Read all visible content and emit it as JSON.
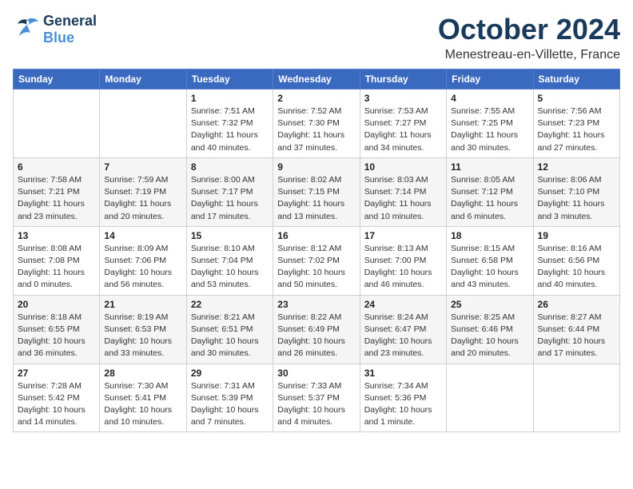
{
  "header": {
    "logo_general": "General",
    "logo_blue": "Blue",
    "month_title": "October 2024",
    "location": "Menestreau-en-Villette, France"
  },
  "weekdays": [
    "Sunday",
    "Monday",
    "Tuesday",
    "Wednesday",
    "Thursday",
    "Friday",
    "Saturday"
  ],
  "weeks": [
    [
      {
        "day": "",
        "info": ""
      },
      {
        "day": "",
        "info": ""
      },
      {
        "day": "1",
        "info": "Sunrise: 7:51 AM\nSunset: 7:32 PM\nDaylight: 11 hours\nand 40 minutes."
      },
      {
        "day": "2",
        "info": "Sunrise: 7:52 AM\nSunset: 7:30 PM\nDaylight: 11 hours\nand 37 minutes."
      },
      {
        "day": "3",
        "info": "Sunrise: 7:53 AM\nSunset: 7:27 PM\nDaylight: 11 hours\nand 34 minutes."
      },
      {
        "day": "4",
        "info": "Sunrise: 7:55 AM\nSunset: 7:25 PM\nDaylight: 11 hours\nand 30 minutes."
      },
      {
        "day": "5",
        "info": "Sunrise: 7:56 AM\nSunset: 7:23 PM\nDaylight: 11 hours\nand 27 minutes."
      }
    ],
    [
      {
        "day": "6",
        "info": "Sunrise: 7:58 AM\nSunset: 7:21 PM\nDaylight: 11 hours\nand 23 minutes."
      },
      {
        "day": "7",
        "info": "Sunrise: 7:59 AM\nSunset: 7:19 PM\nDaylight: 11 hours\nand 20 minutes."
      },
      {
        "day": "8",
        "info": "Sunrise: 8:00 AM\nSunset: 7:17 PM\nDaylight: 11 hours\nand 17 minutes."
      },
      {
        "day": "9",
        "info": "Sunrise: 8:02 AM\nSunset: 7:15 PM\nDaylight: 11 hours\nand 13 minutes."
      },
      {
        "day": "10",
        "info": "Sunrise: 8:03 AM\nSunset: 7:14 PM\nDaylight: 11 hours\nand 10 minutes."
      },
      {
        "day": "11",
        "info": "Sunrise: 8:05 AM\nSunset: 7:12 PM\nDaylight: 11 hours\nand 6 minutes."
      },
      {
        "day": "12",
        "info": "Sunrise: 8:06 AM\nSunset: 7:10 PM\nDaylight: 11 hours\nand 3 minutes."
      }
    ],
    [
      {
        "day": "13",
        "info": "Sunrise: 8:08 AM\nSunset: 7:08 PM\nDaylight: 11 hours\nand 0 minutes."
      },
      {
        "day": "14",
        "info": "Sunrise: 8:09 AM\nSunset: 7:06 PM\nDaylight: 10 hours\nand 56 minutes."
      },
      {
        "day": "15",
        "info": "Sunrise: 8:10 AM\nSunset: 7:04 PM\nDaylight: 10 hours\nand 53 minutes."
      },
      {
        "day": "16",
        "info": "Sunrise: 8:12 AM\nSunset: 7:02 PM\nDaylight: 10 hours\nand 50 minutes."
      },
      {
        "day": "17",
        "info": "Sunrise: 8:13 AM\nSunset: 7:00 PM\nDaylight: 10 hours\nand 46 minutes."
      },
      {
        "day": "18",
        "info": "Sunrise: 8:15 AM\nSunset: 6:58 PM\nDaylight: 10 hours\nand 43 minutes."
      },
      {
        "day": "19",
        "info": "Sunrise: 8:16 AM\nSunset: 6:56 PM\nDaylight: 10 hours\nand 40 minutes."
      }
    ],
    [
      {
        "day": "20",
        "info": "Sunrise: 8:18 AM\nSunset: 6:55 PM\nDaylight: 10 hours\nand 36 minutes."
      },
      {
        "day": "21",
        "info": "Sunrise: 8:19 AM\nSunset: 6:53 PM\nDaylight: 10 hours\nand 33 minutes."
      },
      {
        "day": "22",
        "info": "Sunrise: 8:21 AM\nSunset: 6:51 PM\nDaylight: 10 hours\nand 30 minutes."
      },
      {
        "day": "23",
        "info": "Sunrise: 8:22 AM\nSunset: 6:49 PM\nDaylight: 10 hours\nand 26 minutes."
      },
      {
        "day": "24",
        "info": "Sunrise: 8:24 AM\nSunset: 6:47 PM\nDaylight: 10 hours\nand 23 minutes."
      },
      {
        "day": "25",
        "info": "Sunrise: 8:25 AM\nSunset: 6:46 PM\nDaylight: 10 hours\nand 20 minutes."
      },
      {
        "day": "26",
        "info": "Sunrise: 8:27 AM\nSunset: 6:44 PM\nDaylight: 10 hours\nand 17 minutes."
      }
    ],
    [
      {
        "day": "27",
        "info": "Sunrise: 7:28 AM\nSunset: 5:42 PM\nDaylight: 10 hours\nand 14 minutes."
      },
      {
        "day": "28",
        "info": "Sunrise: 7:30 AM\nSunset: 5:41 PM\nDaylight: 10 hours\nand 10 minutes."
      },
      {
        "day": "29",
        "info": "Sunrise: 7:31 AM\nSunset: 5:39 PM\nDaylight: 10 hours\nand 7 minutes."
      },
      {
        "day": "30",
        "info": "Sunrise: 7:33 AM\nSunset: 5:37 PM\nDaylight: 10 hours\nand 4 minutes."
      },
      {
        "day": "31",
        "info": "Sunrise: 7:34 AM\nSunset: 5:36 PM\nDaylight: 10 hours\nand 1 minute."
      },
      {
        "day": "",
        "info": ""
      },
      {
        "day": "",
        "info": ""
      }
    ]
  ]
}
